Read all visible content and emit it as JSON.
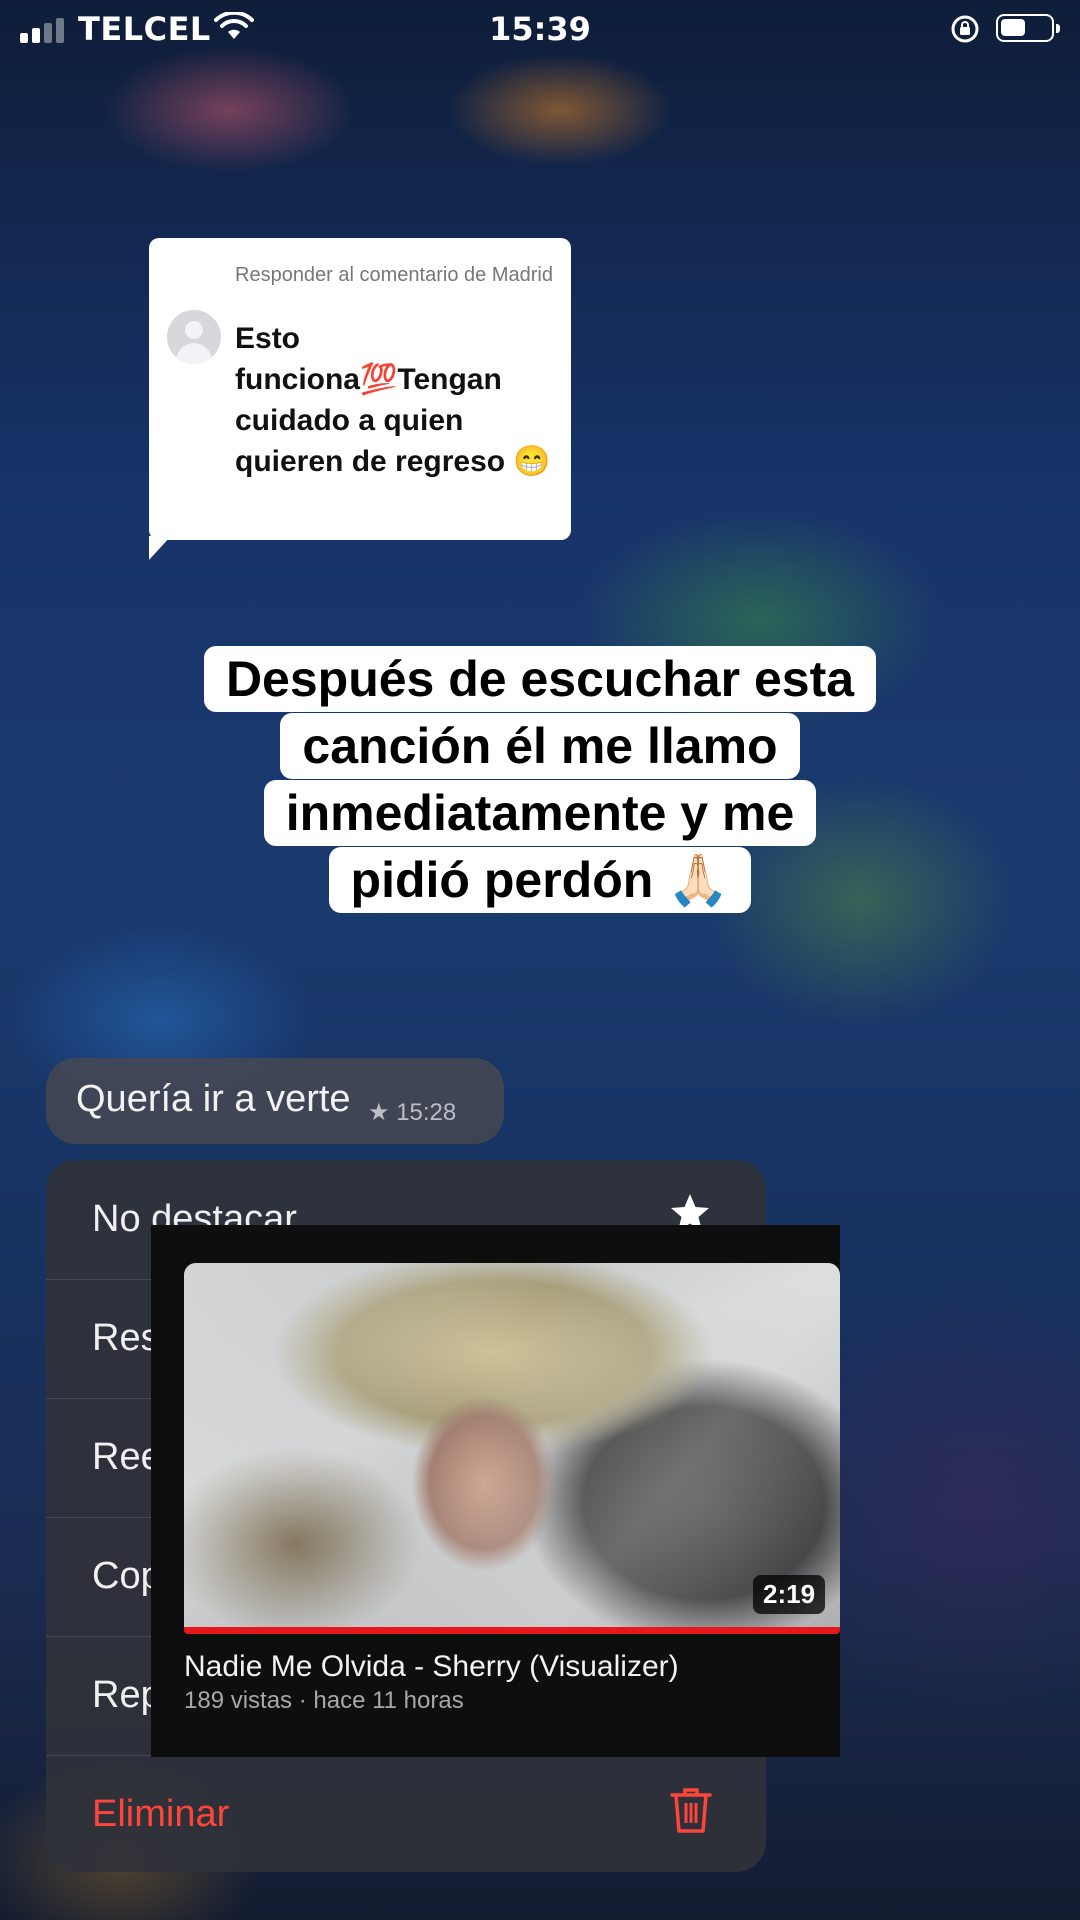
{
  "status_bar": {
    "carrier": "TELCEL",
    "time": "15:39"
  },
  "reply_comment": {
    "header": "Responder al comentario de Madrid",
    "text": "Esto funciona💯Tengan cuidado a quien quieren de regreso 😁"
  },
  "caption": {
    "lines": [
      "Después de escuchar esta",
      "canción él me llamo",
      "inmediatamente y me",
      "pidió perdón 🙏🏻"
    ]
  },
  "message": {
    "text": "Quería ir a verte",
    "time": "15:28",
    "starred_icon": "star-icon"
  },
  "context_menu": {
    "items": [
      {
        "label": "No destacar",
        "icon": "star-icon"
      },
      {
        "label": "Responder",
        "icon": "reply-icon"
      },
      {
        "label": "Reenviar",
        "icon": "forward-icon"
      },
      {
        "label": "Copiar",
        "icon": "copy-icon"
      },
      {
        "label": "Reportar",
        "icon": "report-icon"
      },
      {
        "label": "Eliminar",
        "icon": "trash-icon"
      }
    ],
    "danger_color": "#ff453a"
  },
  "video_card": {
    "duration": "2:19",
    "title": "Nadie Me Olvida - Sherry (Visualizer)",
    "meta": "189 vistas · hace 11 horas",
    "progress": 1.0,
    "progress_color": "#e5181d"
  }
}
